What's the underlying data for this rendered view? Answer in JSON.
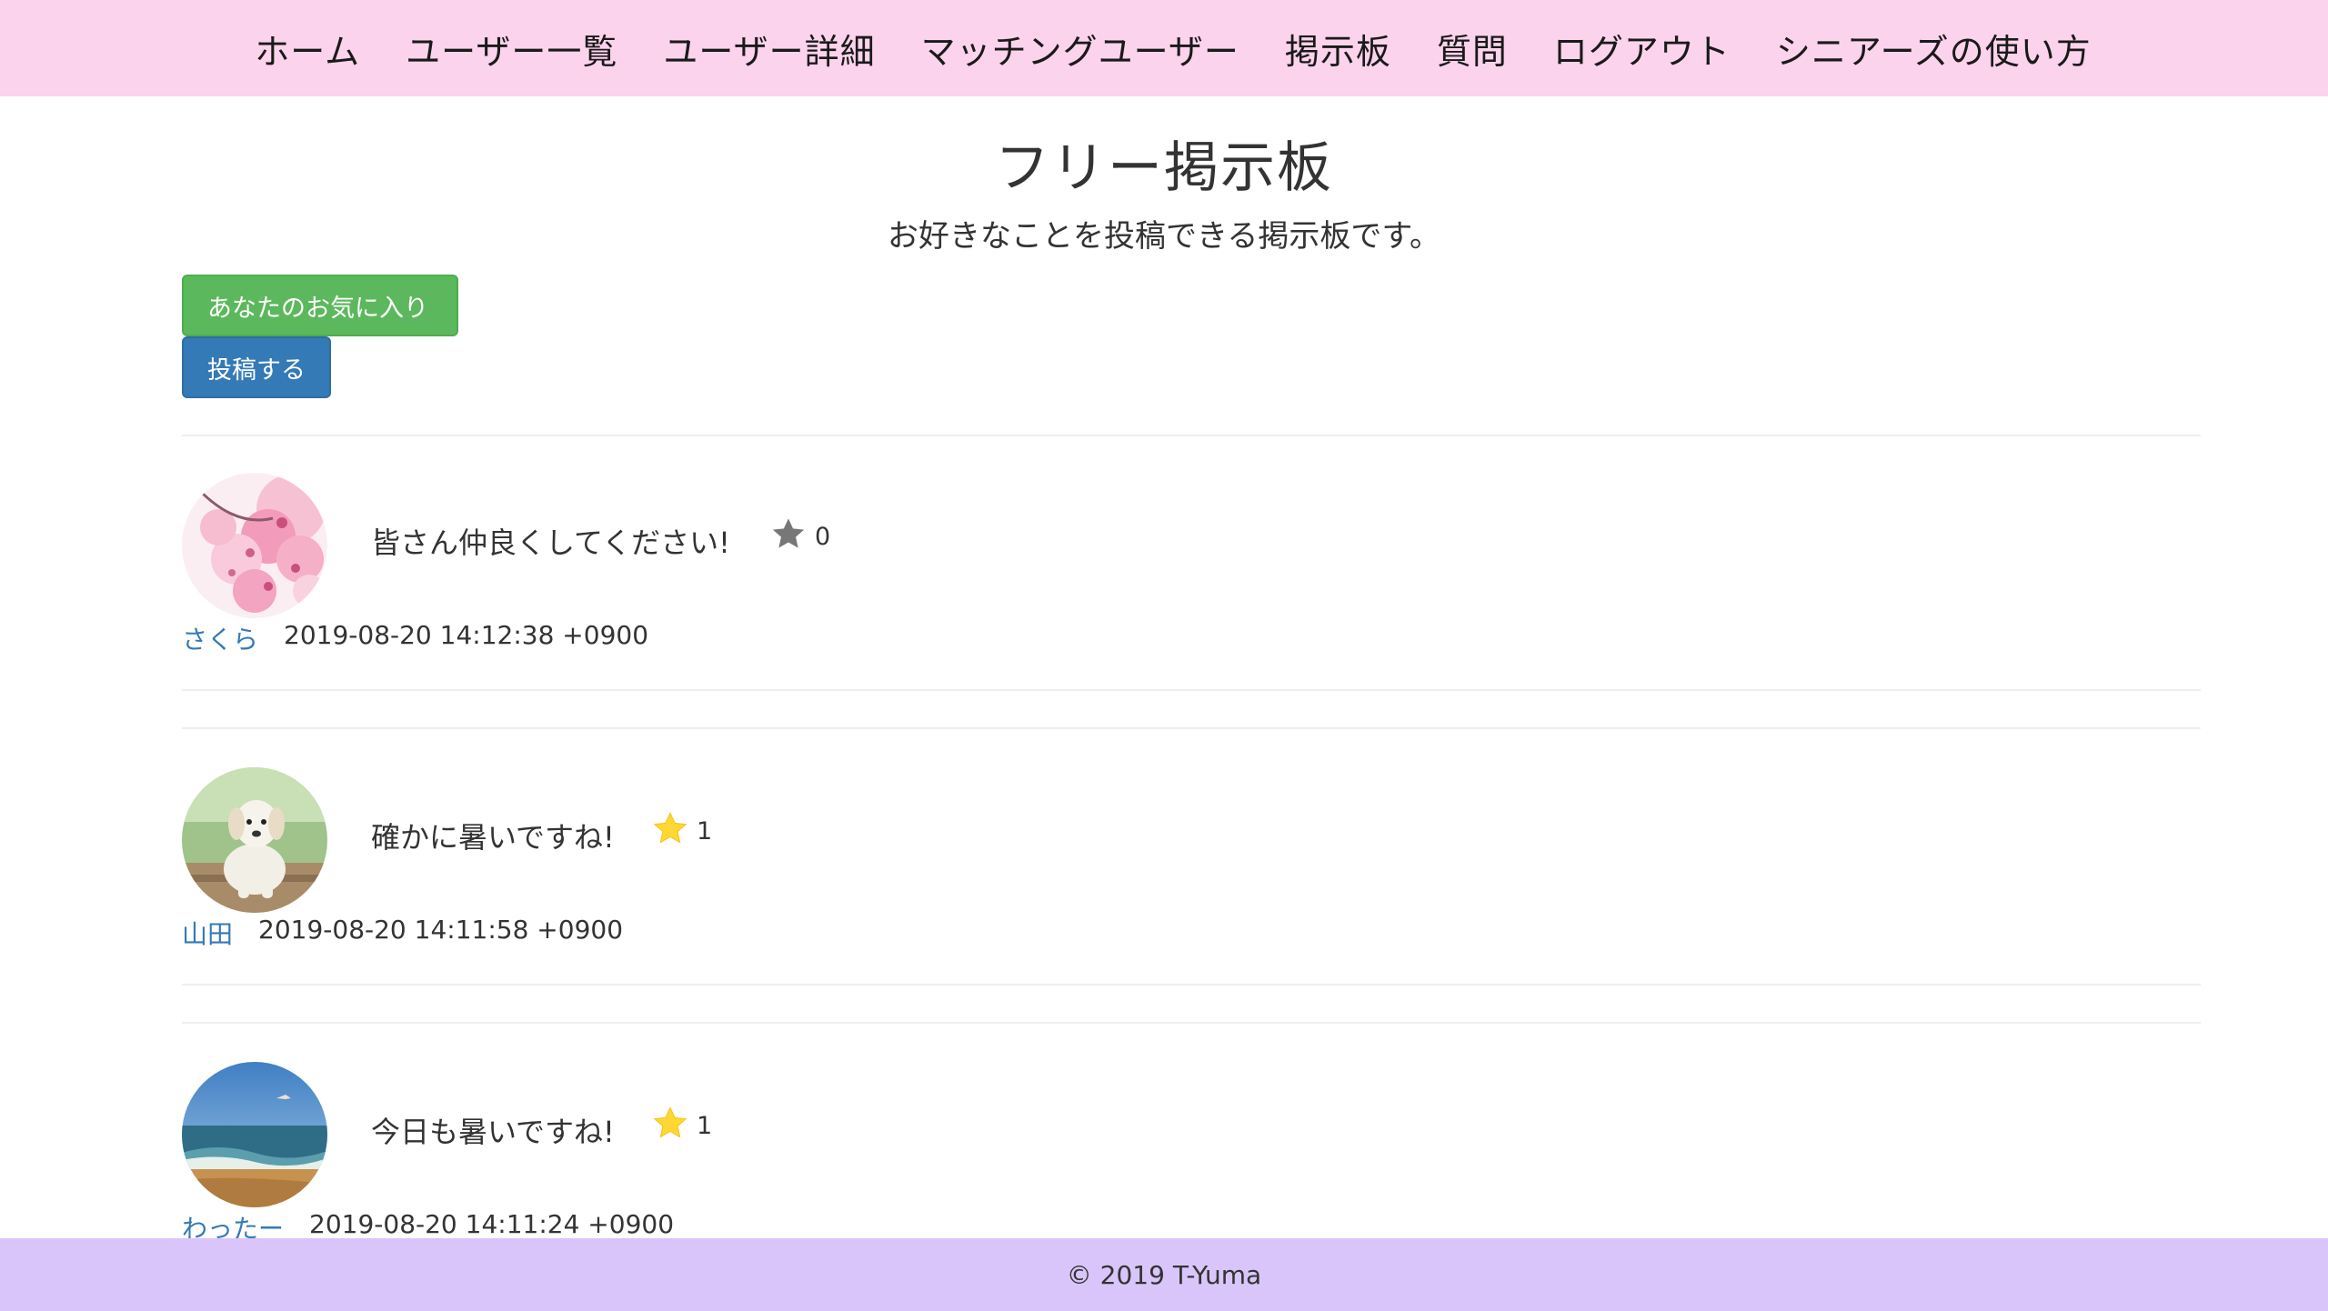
{
  "nav": {
    "items": [
      {
        "label": "ホーム"
      },
      {
        "label": "ユーザー一覧"
      },
      {
        "label": "ユーザー詳細"
      },
      {
        "label": "マッチングユーザー"
      },
      {
        "label": "掲示板"
      },
      {
        "label": "質問"
      },
      {
        "label": "ログアウト"
      },
      {
        "label": "シニアーズの使い方"
      }
    ],
    "background": "#fcd3ec"
  },
  "header": {
    "title": "フリー掲示板",
    "subtitle": "お好きなことを投稿できる掲示板です。"
  },
  "actions": {
    "favorites_label": "あなたのお気に入り",
    "favorites_color": "#5cb85c",
    "post_label": "投稿する",
    "post_color": "#337ab7"
  },
  "posts": [
    {
      "avatar": "cherry-blossom-avatar",
      "text": "皆さん仲良くしてください!",
      "star_icon": "star-icon-gray",
      "star_color": "#777777",
      "likes": "0",
      "author": "さくら",
      "timestamp": "2019-08-20 14:12:38 +0900"
    },
    {
      "avatar": "puppy-avatar",
      "text": "確かに暑いですね!",
      "star_icon": "star-icon-yellow",
      "star_color": "#fdd835",
      "likes": "1",
      "author": "山田",
      "timestamp": "2019-08-20 14:11:58 +0900"
    },
    {
      "avatar": "beach-avatar",
      "text": "今日も暑いですね!",
      "star_icon": "star-icon-yellow",
      "star_color": "#fdd835",
      "likes": "1",
      "author": "わったー",
      "timestamp": "2019-08-20 14:11:24 +0900"
    }
  ],
  "footer": {
    "copyright": "© 2019 T-Yuma",
    "background": "#dac5fb"
  },
  "colors": {
    "link": "#337ab7",
    "text": "#333333"
  }
}
